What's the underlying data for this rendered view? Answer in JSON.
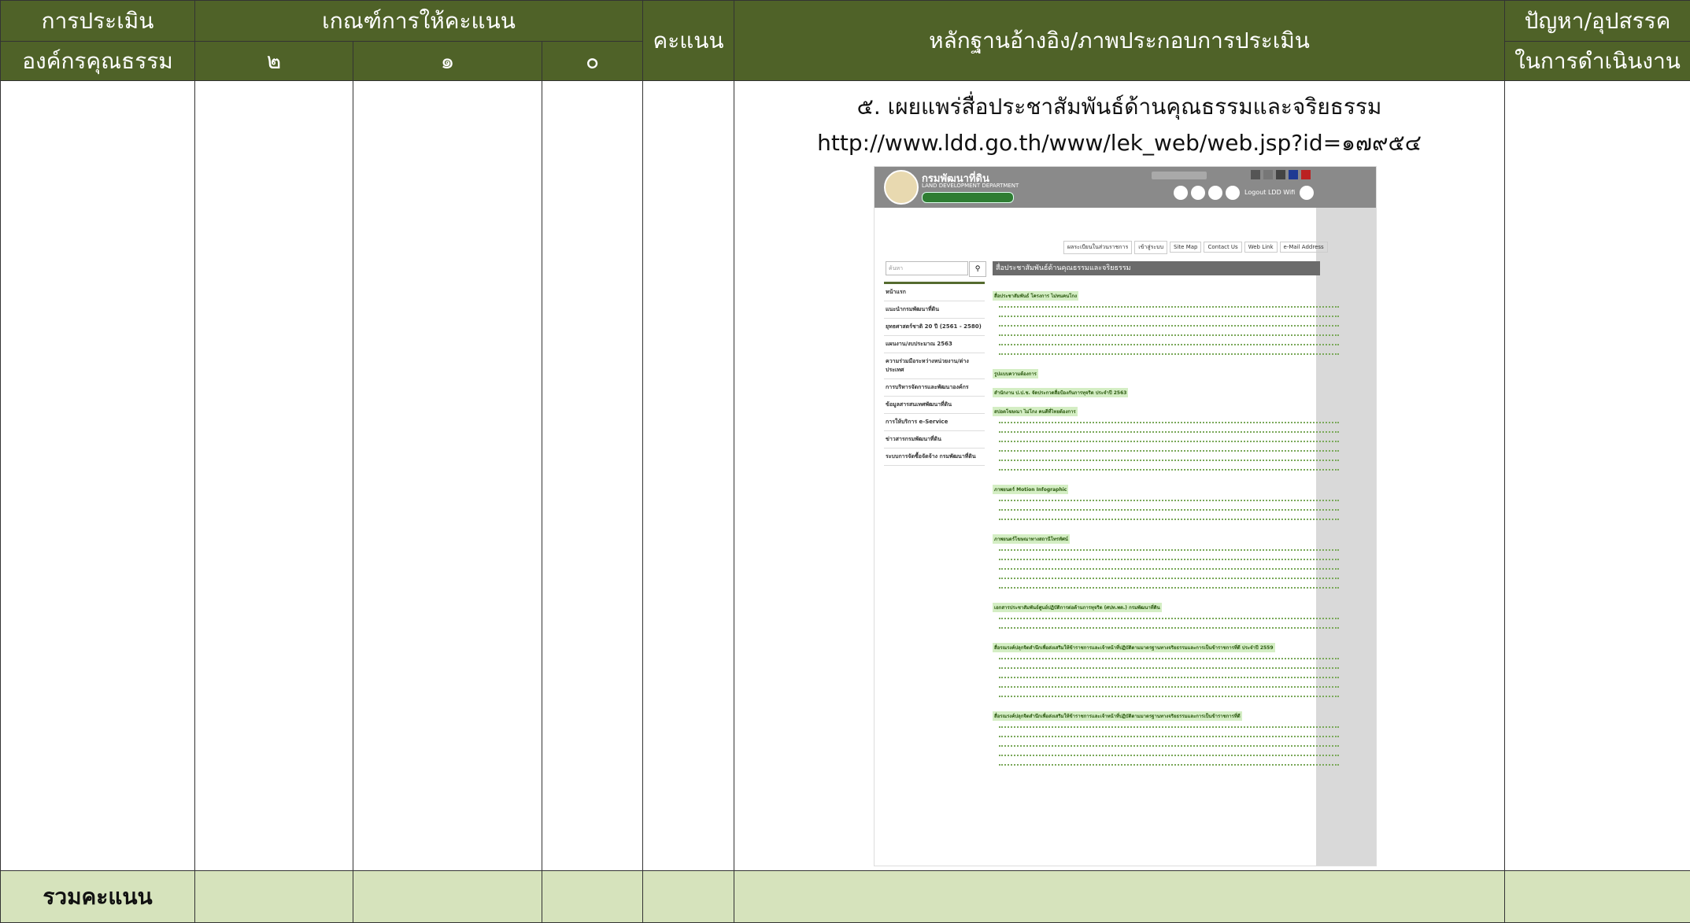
{
  "table": {
    "headers": {
      "col1_line1": "การประเมิน",
      "col1_line2": "องค์กรคุณธรรม",
      "criteria": "เกณฑ์การให้คะแนน",
      "criteria_2": "๒",
      "criteria_1": "๑",
      "criteria_0": "๐",
      "score": "คะแนน",
      "evidence": "หลักฐานอ้างอิง/ภาพประกอบการประเมิน",
      "problems_line1": "ปัญหา/อุปสรรค",
      "problems_line2": "ในการดำเนินงาน"
    },
    "evidence": {
      "title": "๕. เผยแพร่สื่อประชาสัมพันธ์ด้านคุณธรรมและจริยธรรม",
      "url": "http://www.ldd.go.th/www/lek_web/web.jsp?id=๑๗๙๕๔"
    },
    "footer": {
      "total_label": "รวมคะแนน"
    }
  },
  "colors": {
    "header_bg": "#4f6228",
    "footer_bg": "#d6e3bc"
  },
  "screenshot": {
    "org_name_th": "กรมพัฒนาที่ดิน",
    "org_name_en": "LAND DEVELOPMENT DEPARTMENT",
    "logout": "Logout LDD Wifi",
    "search_placeholder": "ค้นหา",
    "page_heading": "สื่อประชาสัมพันธ์ด้านคุณธรรมและจริยธรรม",
    "nav_links": [
      "ผลระเบียนในส่วนราชการ",
      "เข้าสู่ระบบ",
      "Site Map",
      "Contact Us",
      "Web Link",
      "e-Mail Address"
    ],
    "menu": [
      "หน้าแรก",
      "แนะนำกรมพัฒนาที่ดิน",
      "ยุทธศาสตร์ชาติ 20 ปี (2561 - 2580)",
      "แผนงาน/งบประมาณ 2563",
      "ความร่วมมือระหว่างหน่วยงาน/ต่างประเทศ",
      "การบริหารจัดการและพัฒนาองค์กร",
      "ข้อมูลสารสนเทศพัฒนาที่ดิน",
      "การให้บริการ e-Service",
      "ข่าวสารกรมพัฒนาที่ดิน",
      "ระบบการจัดซื้อจัดจ้าง กรมพัฒนาที่ดิน"
    ],
    "sections": [
      "สื่อประชาสัมพันธ์ โครงการ ไม่ทนคนโกง",
      "รูปแบบความต้องการ",
      "สำนักงาน ป.ป.ช. จัดประกวดสื่อป้องกันการทุจริต ประจำปี 2563",
      "สปอตโฆษณา ไม่โกง คนดีที่ไทยต้องการ",
      "ภาพยนตร์ Motion Infographic",
      "ภาพยนตร์โฆษณาทางสถานีโทรทัศน์",
      "เอกสารประชาสัมพันธ์ศูนย์ปฏิบัติการต่อต้านการทุจริต (ศปท.พด.) กรมพัฒนาที่ดิน",
      "สื่อรณรงค์ปลุกจิตสำนึกเพื่อส่งเสริมให้ข้าราชการและเจ้าหน้าที่ปฏิบัติตามมาตรฐานทางจริยธรรมและการเป็นข้าราชการที่ดี ประจำปี 2559",
      "สื่อรณรงค์ปลุกจิตสำนึกเพื่อส่งเสริมให้ข้าราชการและเจ้าหน้าที่ปฏิบัติตามมาตรฐานทางจริยธรรมและการเป็นข้าราชการที่ดี"
    ]
  }
}
